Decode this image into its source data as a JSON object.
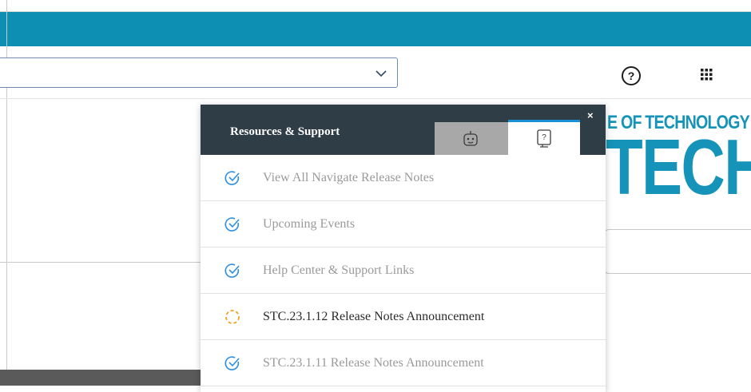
{
  "header": {
    "help_icon": "question-circle-icon",
    "apps_icon": "apps-grid-icon"
  },
  "dropdown": {
    "value": "",
    "icon": "chevron-down-icon"
  },
  "brand": {
    "line1": "E OF TECHNOLOGY",
    "line2": "TECH"
  },
  "panel": {
    "title": "Resources & Support",
    "close_label": "×",
    "tabs": [
      {
        "name": "chatbot",
        "icon": "robot-icon",
        "active": false
      },
      {
        "name": "help",
        "icon": "help-book-icon",
        "active": true
      }
    ],
    "items": [
      {
        "label": "View All Navigate Release Notes",
        "status": "read",
        "icon": "check-circle-icon"
      },
      {
        "label": "Upcoming Events",
        "status": "read",
        "icon": "check-circle-icon"
      },
      {
        "label": "Help Center & Support Links",
        "status": "read",
        "icon": "check-circle-icon"
      },
      {
        "label": "STC.23.1.12 Release Notes Announcement",
        "status": "unread",
        "icon": "dashed-circle-icon"
      },
      {
        "label": "STC.23.1.11 Release Notes Announcement",
        "status": "read",
        "icon": "check-circle-icon"
      }
    ]
  },
  "colors": {
    "topbar": "#0c8fb2",
    "panel_header": "#2f3d47",
    "check": "#2d8fe0",
    "unread": "#f0a020",
    "brand": "#1593b8"
  }
}
